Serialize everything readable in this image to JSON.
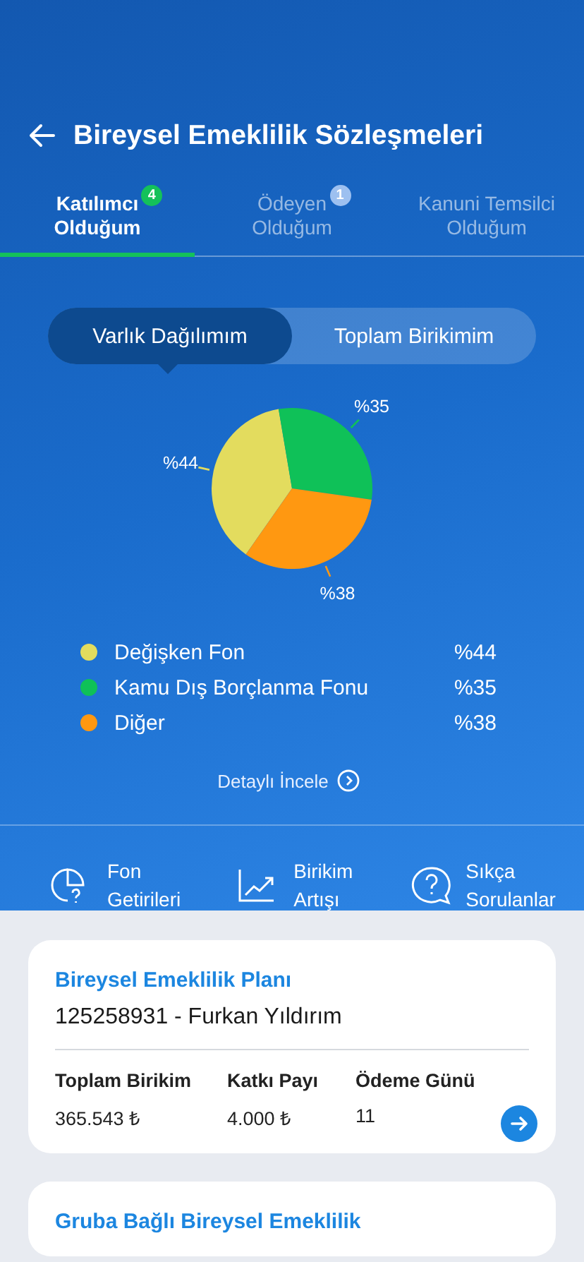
{
  "header": {
    "title": "Bireysel Emeklilik Sözleşmeleri"
  },
  "tabs": [
    {
      "lines": [
        "Katılımcı",
        "Olduğum"
      ],
      "badge": "4",
      "selected": true
    },
    {
      "lines": [
        "Ödeyen",
        "Olduğum"
      ],
      "badge": "1",
      "selected": false
    },
    {
      "lines": [
        "Kanuni Temsilci",
        "Olduğum"
      ],
      "selected": false
    }
  ],
  "segments": [
    {
      "label": "Varlık Dağılımım",
      "selected": true
    },
    {
      "label": "Toplam Birikimim",
      "selected": false
    }
  ],
  "chart_data": {
    "type": "pie",
    "categories": [
      "Değişken Fon",
      "Kamu Dış Borçlanma Fonu",
      "Diğer"
    ],
    "values": [
      44,
      35,
      38
    ],
    "value_labels": [
      "%44",
      "%35",
      "%38"
    ]
  },
  "legend": [
    {
      "value": "%44",
      "color": "#e3dc5e"
    },
    {
      "value": "%35",
      "color": "#0fc158"
    },
    {
      "value": "%38",
      "color": "#ff9811"
    }
  ],
  "detail_link": "Detaylı İncele",
  "shortcuts": [
    {
      "kind": "pie",
      "lines": [
        "Fon",
        "Getirileri"
      ]
    },
    {
      "kind": "growth",
      "lines": [
        "Birikim",
        "Artışı"
      ]
    },
    {
      "kind": "faq",
      "lines": [
        "Sıkça",
        "Sorulanlar"
      ]
    }
  ],
  "cards": [
    {
      "title": "Bireysel Emeklilik Planı",
      "subtitle": "125258931 - Furkan Yıldırım",
      "fields": [
        {
          "label": "Toplam Birikim",
          "value": "365.543 ₺"
        },
        {
          "label": "Katkı Payı",
          "value": "4.000 ₺"
        },
        {
          "label": "Ödeme Günü",
          "value": "11"
        }
      ],
      "arrow": true
    },
    {
      "title": "Gruba Bağlı Bireysel Emeklilik"
    }
  ]
}
